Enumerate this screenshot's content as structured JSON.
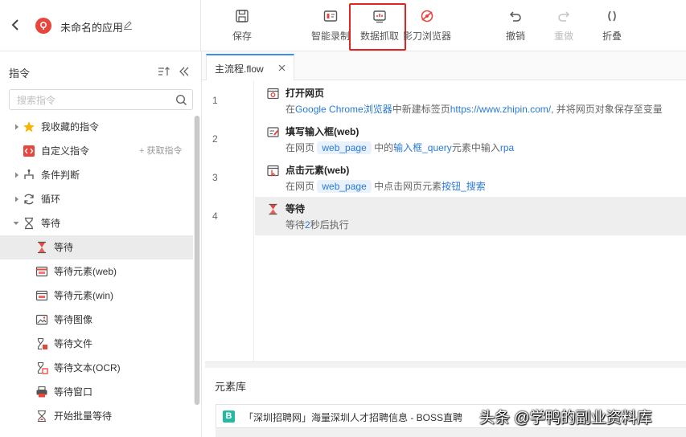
{
  "header": {
    "app_name": "未命名的应用",
    "tools": {
      "save": "保存",
      "smart_record": "智能录制",
      "data_capture": "数据抓取",
      "shadowblade_browser": "影刀浏览器",
      "undo": "撤销",
      "redo": "重做",
      "fold": "折叠"
    }
  },
  "left_panel": {
    "title": "指令",
    "search_placeholder": "搜索指令",
    "fetch_link": "+ 获取指令",
    "items": [
      {
        "label": "我收藏的指令"
      },
      {
        "label": "自定义指令"
      },
      {
        "label": "条件判断"
      },
      {
        "label": "循环"
      },
      {
        "label": "等待"
      },
      {
        "label": "等待"
      },
      {
        "label": "等待元素(web)"
      },
      {
        "label": "等待元素(win)"
      },
      {
        "label": "等待图像"
      },
      {
        "label": "等待文件"
      },
      {
        "label": "等待文本(OCR)"
      },
      {
        "label": "等待窗口"
      },
      {
        "label": "开始批量等待"
      }
    ]
  },
  "editor": {
    "tab_name": "主流程.flow",
    "steps": [
      {
        "line": "1",
        "title": "打开网页",
        "desc": {
          "p1": "在",
          "browser": "Google Chrome浏览器",
          "p2": "中新建标签页",
          "url": "https://www.zhipin.com/",
          "p3": ", 并将网页对象保存至变量"
        }
      },
      {
        "line": "2",
        "title": "填写输入框(web)",
        "desc": {
          "p1": "在网页",
          "chip": "web_page",
          "p2": "中的",
          "element": "输入框_query",
          "p3": "元素中输入",
          "value": "rpa"
        }
      },
      {
        "line": "3",
        "title": "点击元素(web)",
        "desc": {
          "p1": "在网页",
          "chip": "web_page",
          "p2": "中点击网页元素",
          "element": "按钮_搜索"
        }
      },
      {
        "line": "4",
        "title": "等待",
        "desc": {
          "p1": "等待",
          "value": "2",
          "p2": "秒后执行"
        }
      }
    ]
  },
  "element_library": {
    "title": "元素库",
    "item_icon": "B",
    "item_label": "「深圳招聘网」海量深圳人才招聘信息 - BOSS直聘"
  },
  "watermark": "头条 @学鸭的副业资料库",
  "colors": {
    "accent": "#3c8df0",
    "link": "#2a7ad5",
    "highlight": "#e02424",
    "logo": "#e8453c"
  }
}
